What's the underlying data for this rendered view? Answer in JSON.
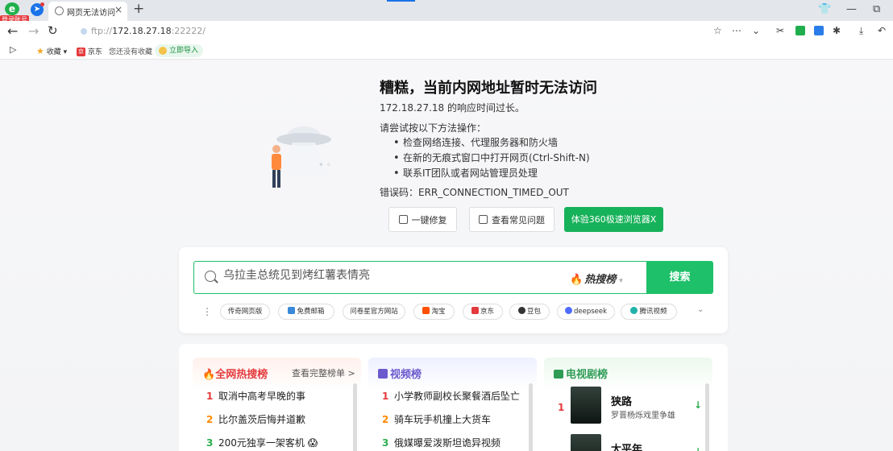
{
  "browser": {
    "login_badge": "登录账号",
    "tab_title": "网页无法访问",
    "url_scheme": "ftp://",
    "url_host": "172.18.27.18",
    "url_rest": ":22222/"
  },
  "bookmarks": {
    "favorites": "收藏",
    "jd": "京东",
    "empty": "您还没有收藏",
    "import": "立即导入"
  },
  "error": {
    "title": "糟糕，当前内网地址暂时无法访问",
    "subtitle": "172.18.27.18 的响应时间过长。",
    "try_heading": "请尝试按以下方法操作：",
    "steps": [
      "检查网络连接、代理服务器和防火墙",
      "在新的无痕式窗口中打开网页(Ctrl-Shift-N)",
      "联系IT团队或者网站管理员处理"
    ],
    "code": "错误码：ERR_CONNECTION_TIMED_OUT",
    "btn_fix": "一键修复",
    "btn_faq": "查看常见问题",
    "btn_try": "体验360极速浏览器X"
  },
  "search": {
    "placeholder": "乌拉圭总统见到烤红薯表情亮",
    "hot_label": "热搜榜",
    "button": "搜索",
    "quick_links": [
      "传奇网页版",
      "免费邮箱",
      "问卷星官方网站",
      "淘宝",
      "京东",
      "豆包",
      "deepseek",
      "腾讯视频"
    ]
  },
  "hot": {
    "panel1_title": "全网热搜榜",
    "panel1_more": "查看完整榜单 >",
    "panel1_items": [
      {
        "rank": "1",
        "text": "取消中高考早晚的事"
      },
      {
        "rank": "2",
        "text": "比尔盖茨后悔并道歉"
      },
      {
        "rank": "3",
        "text": "200元独享一架客机 😱"
      }
    ],
    "panel2_title": "视频榜",
    "panel2_items": [
      {
        "rank": "1",
        "text": "小学教师副校长聚餐酒后坠亡"
      },
      {
        "rank": "2",
        "text": "骑车玩手机撞上大货车"
      },
      {
        "rank": "3",
        "text": "俄媒曝爱泼斯坦诡异视频"
      }
    ],
    "panel3_title": "电视剧榜",
    "panel3_items": [
      {
        "rank": "1",
        "name": "狭路",
        "cast": "罗晋杨烁戏里争雄"
      },
      {
        "rank": "2",
        "name": "太平年",
        "cast": ""
      }
    ]
  },
  "colors": {
    "accent_green": "#1ec06a",
    "hot_red": "#e4393c",
    "video_purple": "#6a5acd",
    "tv_green": "#2eae4e"
  }
}
